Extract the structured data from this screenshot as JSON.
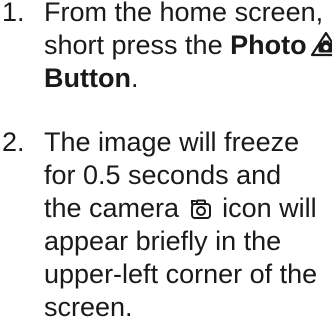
{
  "steps": [
    {
      "number": "1.",
      "lines": {
        "l1": "From the home screen,",
        "l2_pre": "short press the ",
        "l2_bold": "Photo",
        "l3_bold": "Button",
        "l3_post": "."
      },
      "icon": "photo-button-icon"
    },
    {
      "number": "2.",
      "lines": {
        "l1": "The image will freeze",
        "l2": "for 0.5 seconds and",
        "l3_pre": "the camera ",
        "l3_post": " icon will",
        "l4": "appear briefly in the",
        "l5": "upper-left corner of the",
        "l6": "screen."
      },
      "icon": "camera-icon"
    }
  ]
}
